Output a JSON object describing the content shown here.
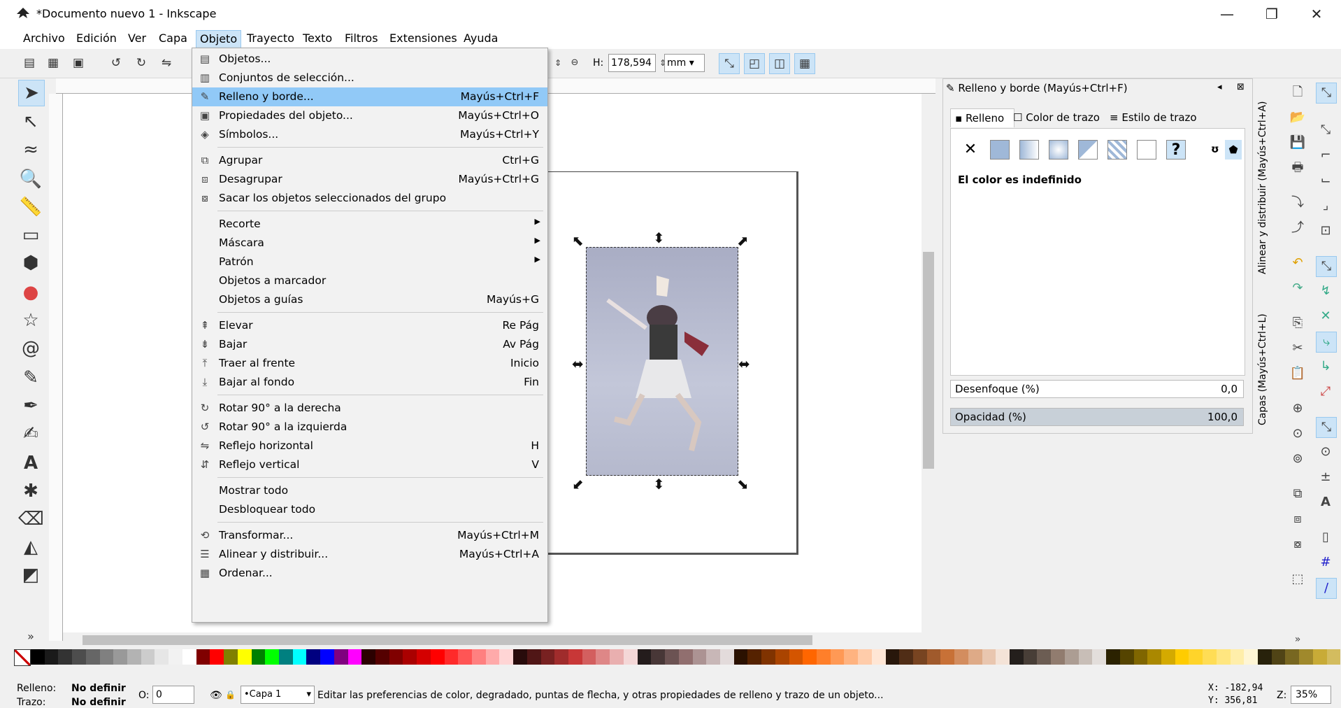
{
  "window": {
    "title": "*Documento nuevo 1 - Inkscape",
    "minimize": "—",
    "restore": "❐",
    "close": "✕"
  },
  "menubar": [
    "Archivo",
    "Edición",
    "Ver",
    "Capa",
    "Objeto",
    "Trayecto",
    "Texto",
    "Filtros",
    "Extensiones",
    "Ayuda"
  ],
  "controls": {
    "h_label": "H:",
    "h_value": "178,594",
    "unit": "mm"
  },
  "object_menu": {
    "items": [
      {
        "icon": "objects-icon",
        "glyph": "▤",
        "label": "Objetos...",
        "shortcut": ""
      },
      {
        "icon": "selection-sets-icon",
        "glyph": "▥",
        "label": "Conjuntos de selección...",
        "shortcut": ""
      },
      {
        "icon": "fill-stroke-icon",
        "glyph": "✎",
        "label": "Relleno y borde...",
        "shortcut": "Mayús+Ctrl+F",
        "selected": true
      },
      {
        "icon": "object-properties-icon",
        "glyph": "▣",
        "label": "Propiedades del objeto...",
        "shortcut": "Mayús+Ctrl+O"
      },
      {
        "icon": "symbols-icon",
        "glyph": "◈",
        "label": "Símbolos...",
        "shortcut": "Mayús+Ctrl+Y"
      },
      {
        "icon": "group-icon",
        "glyph": "⧉",
        "label": "Agrupar",
        "shortcut": "Ctrl+G"
      },
      {
        "icon": "ungroup-icon",
        "glyph": "⧈",
        "label": "Desagrupar",
        "shortcut": "Mayús+Ctrl+G"
      },
      {
        "icon": "pop-from-group-icon",
        "glyph": "⧇",
        "label": "Sacar los objetos seleccionados del grupo",
        "shortcut": ""
      },
      {
        "icon": "",
        "glyph": "",
        "label": "Recorte",
        "shortcut": "",
        "submenu": true
      },
      {
        "icon": "",
        "glyph": "",
        "label": "Máscara",
        "shortcut": "",
        "submenu": true
      },
      {
        "icon": "",
        "glyph": "",
        "label": "Patrón",
        "shortcut": "",
        "submenu": true
      },
      {
        "icon": "",
        "glyph": "",
        "label": "Objetos a marcador",
        "shortcut": ""
      },
      {
        "icon": "",
        "glyph": "",
        "label": "Objetos a guías",
        "shortcut": "Mayús+G"
      },
      {
        "icon": "raise-icon",
        "glyph": "⇞",
        "label": "Elevar",
        "shortcut": "Re Pág"
      },
      {
        "icon": "lower-icon",
        "glyph": "⇟",
        "label": "Bajar",
        "shortcut": "Av Pág"
      },
      {
        "icon": "raise-to-top-icon",
        "glyph": "⤒",
        "label": "Traer al frente",
        "shortcut": "Inicio"
      },
      {
        "icon": "lower-to-bottom-icon",
        "glyph": "⤓",
        "label": "Bajar al fondo",
        "shortcut": "Fin"
      },
      {
        "icon": "rotate-cw-icon",
        "glyph": "↻",
        "label": "Rotar 90° a la derecha",
        "shortcut": ""
      },
      {
        "icon": "rotate-ccw-icon",
        "glyph": "↺",
        "label": "Rotar 90° a la izquierda",
        "shortcut": ""
      },
      {
        "icon": "flip-horizontal-icon",
        "glyph": "⇋",
        "label": "Reflejo horizontal",
        "shortcut": "H"
      },
      {
        "icon": "flip-vertical-icon",
        "glyph": "⇵",
        "label": "Reflejo vertical",
        "shortcut": "V"
      },
      {
        "icon": "",
        "glyph": "",
        "label": "Mostrar todo",
        "shortcut": ""
      },
      {
        "icon": "",
        "glyph": "",
        "label": "Desbloquear todo",
        "shortcut": ""
      },
      {
        "icon": "transform-icon",
        "glyph": "⟲",
        "label": "Transformar...",
        "shortcut": "Mayús+Ctrl+M"
      },
      {
        "icon": "align-distribute-icon",
        "glyph": "☰",
        "label": "Alinear y distribuir...",
        "shortcut": "Mayús+Ctrl+A"
      },
      {
        "icon": "arrange-icon",
        "glyph": "▦",
        "label": "Ordenar...",
        "shortcut": ""
      }
    ]
  },
  "fill_dialog": {
    "title": "Relleno y borde (Mayús+Ctrl+F)",
    "tabs": [
      "Relleno",
      "Color de trazo",
      "Estilo de trazo"
    ],
    "undefined_text": "El color es indefinido",
    "blur_label": "Desenfoque (%)",
    "blur_value": "0,0",
    "opacity_label": "Opacidad (%)",
    "opacity_value": "100,0"
  },
  "dock_tabs": {
    "align": "Alinear y distribuir (Mayús+Ctrl+A)",
    "layers": "Capas (Mayús+Ctrl+L)"
  },
  "status": {
    "fill_label": "Relleno:",
    "fill_value": "No definir",
    "stroke_label": "Trazo:",
    "stroke_value": "No definir",
    "o_label": "O:",
    "o_value": "0",
    "layer": "•Capa 1",
    "message": "Editar las preferencias de color, degradado, puntas de flecha, y otras propiedades de relleno y trazo de un objeto...",
    "x_coord": "X: -182,94",
    "y_coord": "Y: 356,81",
    "zoom_label": "Z:",
    "zoom_value": "35%"
  },
  "palette_colors": [
    "#000000",
    "#1a1a1a",
    "#333333",
    "#4d4d4d",
    "#666666",
    "#808080",
    "#999999",
    "#b3b3b3",
    "#cccccc",
    "#e6e6e6",
    "#f2f2f2",
    "#ffffff",
    "#800000",
    "#ff0000",
    "#808000",
    "#ffff00",
    "#008000",
    "#00ff00",
    "#008080",
    "#00ffff",
    "#000080",
    "#0000ff",
    "#800080",
    "#ff00ff",
    "#2b0000",
    "#550000",
    "#800000",
    "#aa0000",
    "#d40000",
    "#ff0000",
    "#ff2a2a",
    "#ff5555",
    "#ff8080",
    "#ffaaaa",
    "#ffd5d5",
    "#280b0b",
    "#501616",
    "#782121",
    "#a02c2c",
    "#c83737",
    "#d35f5f",
    "#de8787",
    "#e9afaf",
    "#f4d7d7",
    "#241c1c",
    "#483737",
    "#6c5353",
    "#916f6f",
    "#ac9393",
    "#c8b7b7",
    "#e3dbdb",
    "#2b1100",
    "#552200",
    "#803300",
    "#aa4400",
    "#d45500",
    "#ff6600",
    "#ff7f2a",
    "#ff9955",
    "#ffb380",
    "#ffccaa",
    "#ffe6d5",
    "#28170b",
    "#502d16",
    "#784421",
    "#a05a2c",
    "#c87137",
    "#d38d5f",
    "#deaa87",
    "#e9c6af",
    "#f4e3d7",
    "#241f1c",
    "#483e37",
    "#6c5d53",
    "#917c6f",
    "#ac9d93",
    "#c8beb7",
    "#e3dedb",
    "#2b2200",
    "#554400",
    "#806600",
    "#aa8800",
    "#d4aa00",
    "#ffcc00",
    "#ffd42a",
    "#ffdd55",
    "#ffe680",
    "#ffeeaa",
    "#fff6d5",
    "#28220b",
    "#504416",
    "#786721",
    "#a0892c",
    "#c8ab37",
    "#d3bc5f"
  ]
}
